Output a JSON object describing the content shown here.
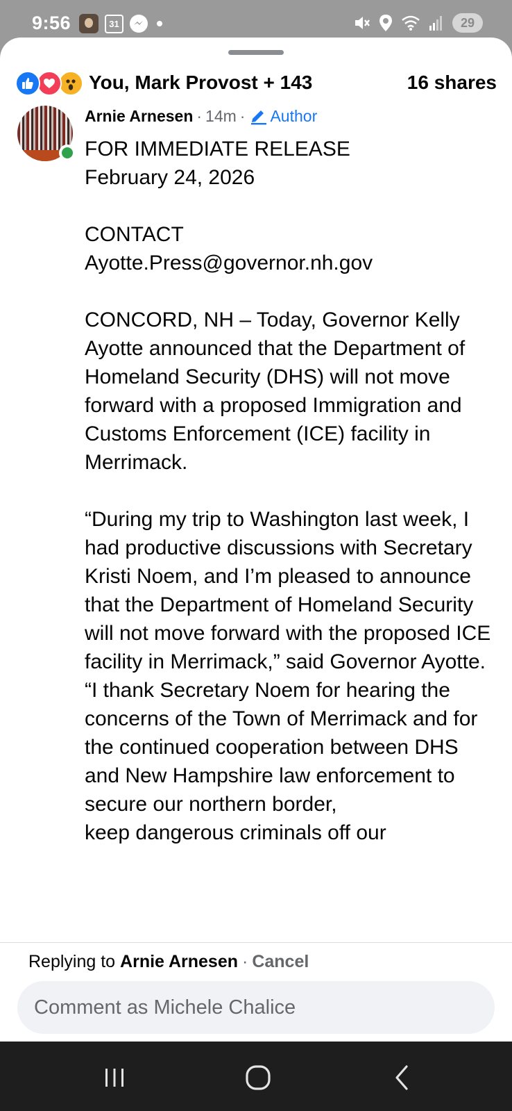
{
  "status_bar": {
    "time": "9:56",
    "calendar_day": "31",
    "battery": "29"
  },
  "reactions": {
    "summary": "You, Mark Provost + 143",
    "shares": "16 shares",
    "icons": [
      "like-icon",
      "love-icon",
      "wow-icon"
    ]
  },
  "comment": {
    "author": "Arnie Arnesen",
    "separator": "·",
    "time_ago": "14m",
    "badge": "Author",
    "body": "FOR IMMEDIATE RELEASE\nFebruary 24, 2026\n\nCONTACT\nAyotte.Press@governor.nh.gov\n\nCONCORD, NH – Today, Governor Kelly Ayotte announced that the Department of\nHomeland Security (DHS) will not move forward with a proposed Immigration and Customs Enforcement (ICE) facility in Merrimack.\n\n“During my trip to Washington last week, I had productive discussions with Secretary Kristi Noem, and I’m pleased to announce that the Department of Homeland Security will not move forward with the proposed ICE facility in Merrimack,” said Governor Ayotte. “I thank Secretary Noem for hearing the concerns of the Town of Merrimack and for the continued cooperation between DHS and New Hampshire law enforcement to secure our northern border,\nkeep dangerous criminals off our"
  },
  "reply": {
    "prefix": "Replying to ",
    "name": "Arnie Arnesen",
    "separator": "·",
    "cancel": "Cancel"
  },
  "composer": {
    "placeholder": "Comment as Michele Chalice"
  },
  "colors": {
    "accent": "#1877f2",
    "online": "#31a24c",
    "love": "#f33e58",
    "wow": "#f7b125",
    "status_bar_bg": "#9a9a9a",
    "nav_bg": "#1e1e1e"
  }
}
